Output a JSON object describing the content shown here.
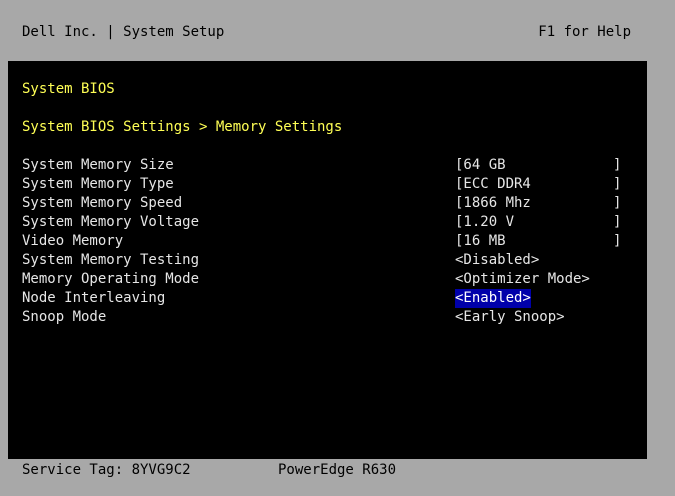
{
  "header": {
    "title": "Dell Inc. | System Setup",
    "help": "F1 for Help"
  },
  "panel": {
    "section_title": "System BIOS",
    "breadcrumb": "System BIOS Settings > Memory Settings"
  },
  "settings": [
    {
      "label": "System Memory Size",
      "value": "[64 GB",
      "end": "]"
    },
    {
      "label": "System Memory Type",
      "value": "[ECC DDR4",
      "end": "]"
    },
    {
      "label": "System Memory Speed",
      "value": "[1866 Mhz",
      "end": "]"
    },
    {
      "label": "System Memory Voltage",
      "value": "[1.20 V",
      "end": "]"
    },
    {
      "label": "Video Memory",
      "value": "[16 MB",
      "end": "]"
    },
    {
      "label": "System Memory Testing",
      "value": "<Disabled>"
    },
    {
      "label": "Memory Operating Mode",
      "value": "<Optimizer Mode>"
    },
    {
      "label": "Node Interleaving",
      "value": "<Enabled>"
    },
    {
      "label": "Snoop Mode",
      "value": "<Early Snoop>"
    }
  ],
  "footer": {
    "service_tag": "Service Tag: 8YVG9C2",
    "model": "PowerEdge R630"
  },
  "colors": {
    "frame": "#a8a8a8",
    "panel": "#000000",
    "heading": "#ffff55",
    "text": "#e6e6e6",
    "selection": "#0000aa"
  }
}
